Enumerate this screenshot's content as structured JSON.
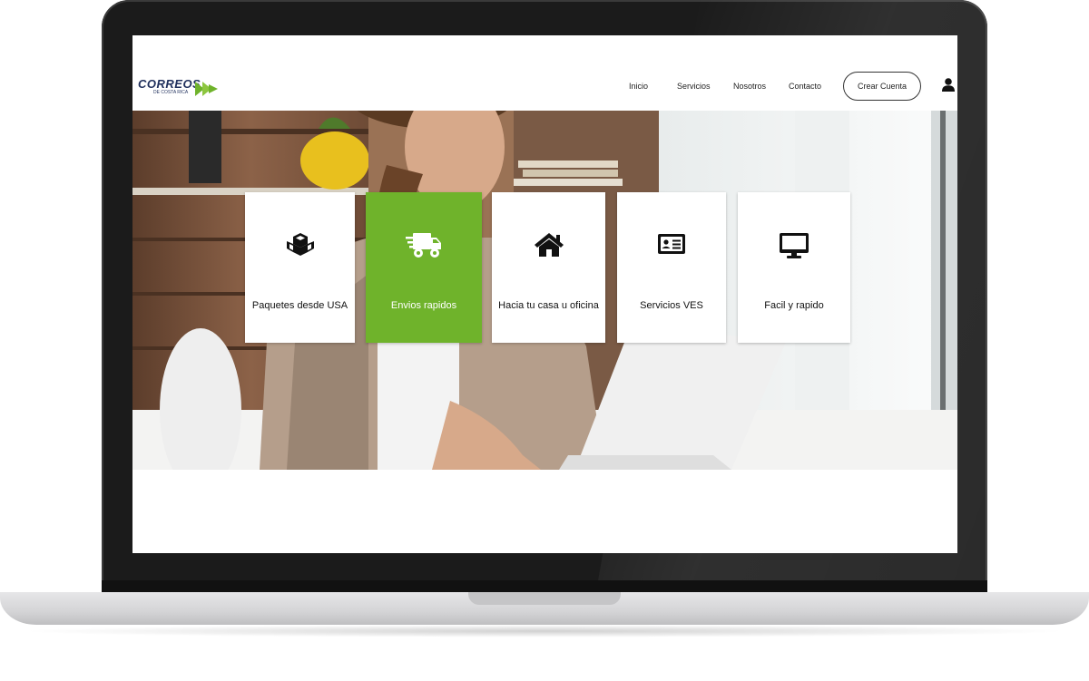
{
  "brand": {
    "logo_text": "CORREOS",
    "logo_subtext": "DE COSTA RICA",
    "accent_color": "#6fb32b",
    "navy_color": "#1f2f5c"
  },
  "nav": {
    "links": [
      "Inicio",
      "Servicios",
      "Nosotros",
      "Contacto"
    ],
    "cta_label": "Crear Cuenta",
    "user_icon": "user-icon"
  },
  "services": [
    {
      "label": "Paquetes desde USA",
      "icon": "cubes-icon",
      "active": false
    },
    {
      "label": "Envios rapidos",
      "icon": "shipping-truck-icon",
      "active": true
    },
    {
      "label": "Hacia tu casa u oficina",
      "icon": "home-icon",
      "active": false
    },
    {
      "label": "Servicios VES",
      "icon": "id-card-icon",
      "active": false
    },
    {
      "label": "Facil y rapido",
      "icon": "desktop-icon",
      "active": false
    }
  ]
}
